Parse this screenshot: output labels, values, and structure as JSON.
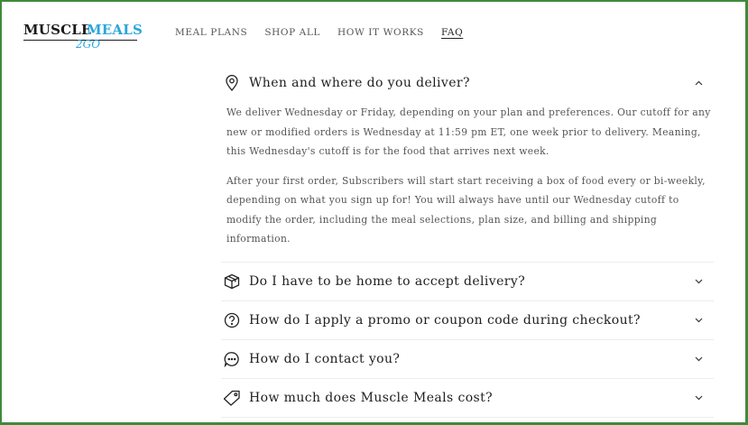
{
  "brand": {
    "word1": "MUSCLE",
    "word2": "MEALS",
    "word3": "2GO",
    "accent_color": "#2aa6dc"
  },
  "nav": [
    {
      "label": "MEAL PLANS",
      "active": false
    },
    {
      "label": "SHOP ALL",
      "active": false
    },
    {
      "label": "HOW IT WORKS",
      "active": false
    },
    {
      "label": "FAQ",
      "active": true
    }
  ],
  "faq": {
    "items": [
      {
        "icon": "map-pin-icon",
        "question": "When and where do you deliver?",
        "open": true,
        "answer": [
          "We deliver Wednesday or Friday, depending on your plan and preferences. Our cutoff for any new or modified orders is Wednesday at 11:59 pm ET, one week prior to delivery. Meaning, this Wednesday's cutoff is for the food that arrives next week.",
          "After your first order, Subscribers will start start receiving a box of food every or bi-weekly, depending on what you sign up for! You will always have until our Wednesday cutoff to modify the order, including the meal selections, plan size, and billing and shipping information."
        ]
      },
      {
        "icon": "box-icon",
        "question": "Do I have to be home to accept delivery?",
        "open": false
      },
      {
        "icon": "question-circle-icon",
        "question": "How do I apply a promo or coupon code during checkout?",
        "open": false
      },
      {
        "icon": "chat-bubble-icon",
        "question": "How do I contact you?",
        "open": false
      },
      {
        "icon": "price-tag-icon",
        "question": "How much does Muscle Meals cost?",
        "open": false
      }
    ]
  },
  "frame_color": "#3f8a3a"
}
